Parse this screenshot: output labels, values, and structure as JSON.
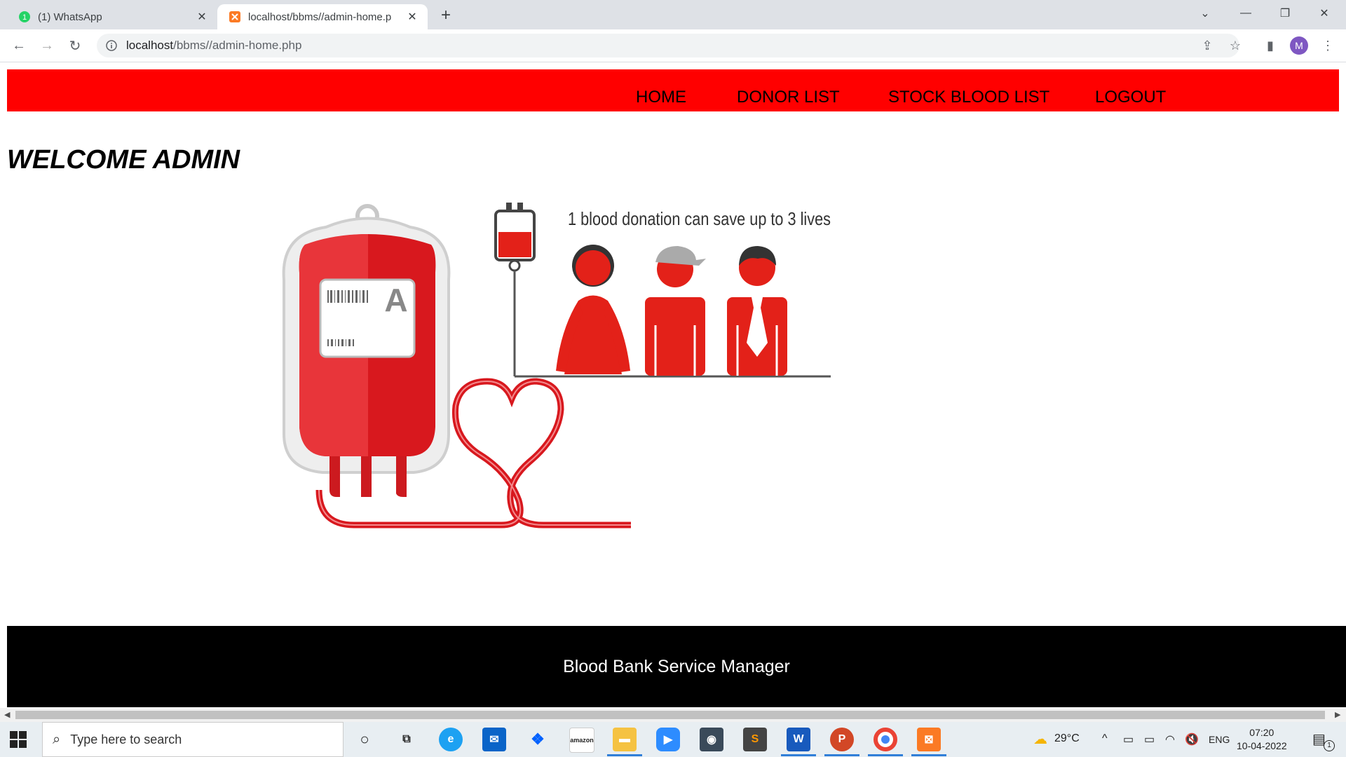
{
  "browser": {
    "tabs": [
      {
        "title": "(1) WhatsApp",
        "active": false,
        "icon": "whatsapp-icon"
      },
      {
        "title": "localhost/bbms//admin-home.p",
        "active": true,
        "icon": "xampp-icon"
      }
    ],
    "new_tab": "+",
    "url_host": "localhost",
    "url_path": "/bbms//admin-home.php",
    "profile_initial": "M"
  },
  "page": {
    "nav": [
      "HOME",
      "DONOR LIST",
      "STOCK BLOOD LIST",
      "LOGOUT"
    ],
    "welcome": "WELCOME ADMIN",
    "hero": {
      "caption": "1 blood donation can save up to 3 lives",
      "bag_label": "A"
    },
    "footer": "Blood Bank Service Manager"
  },
  "taskbar": {
    "search_placeholder": "Type here to search",
    "weather": "29°C",
    "language": "ENG",
    "time": "07:20",
    "date": "10-04-2022",
    "notifications": "1",
    "accent": "#2f7ed8"
  },
  "colors": {
    "navbar": "#ff0000",
    "footer": "#000000",
    "blood": "#e32119"
  }
}
